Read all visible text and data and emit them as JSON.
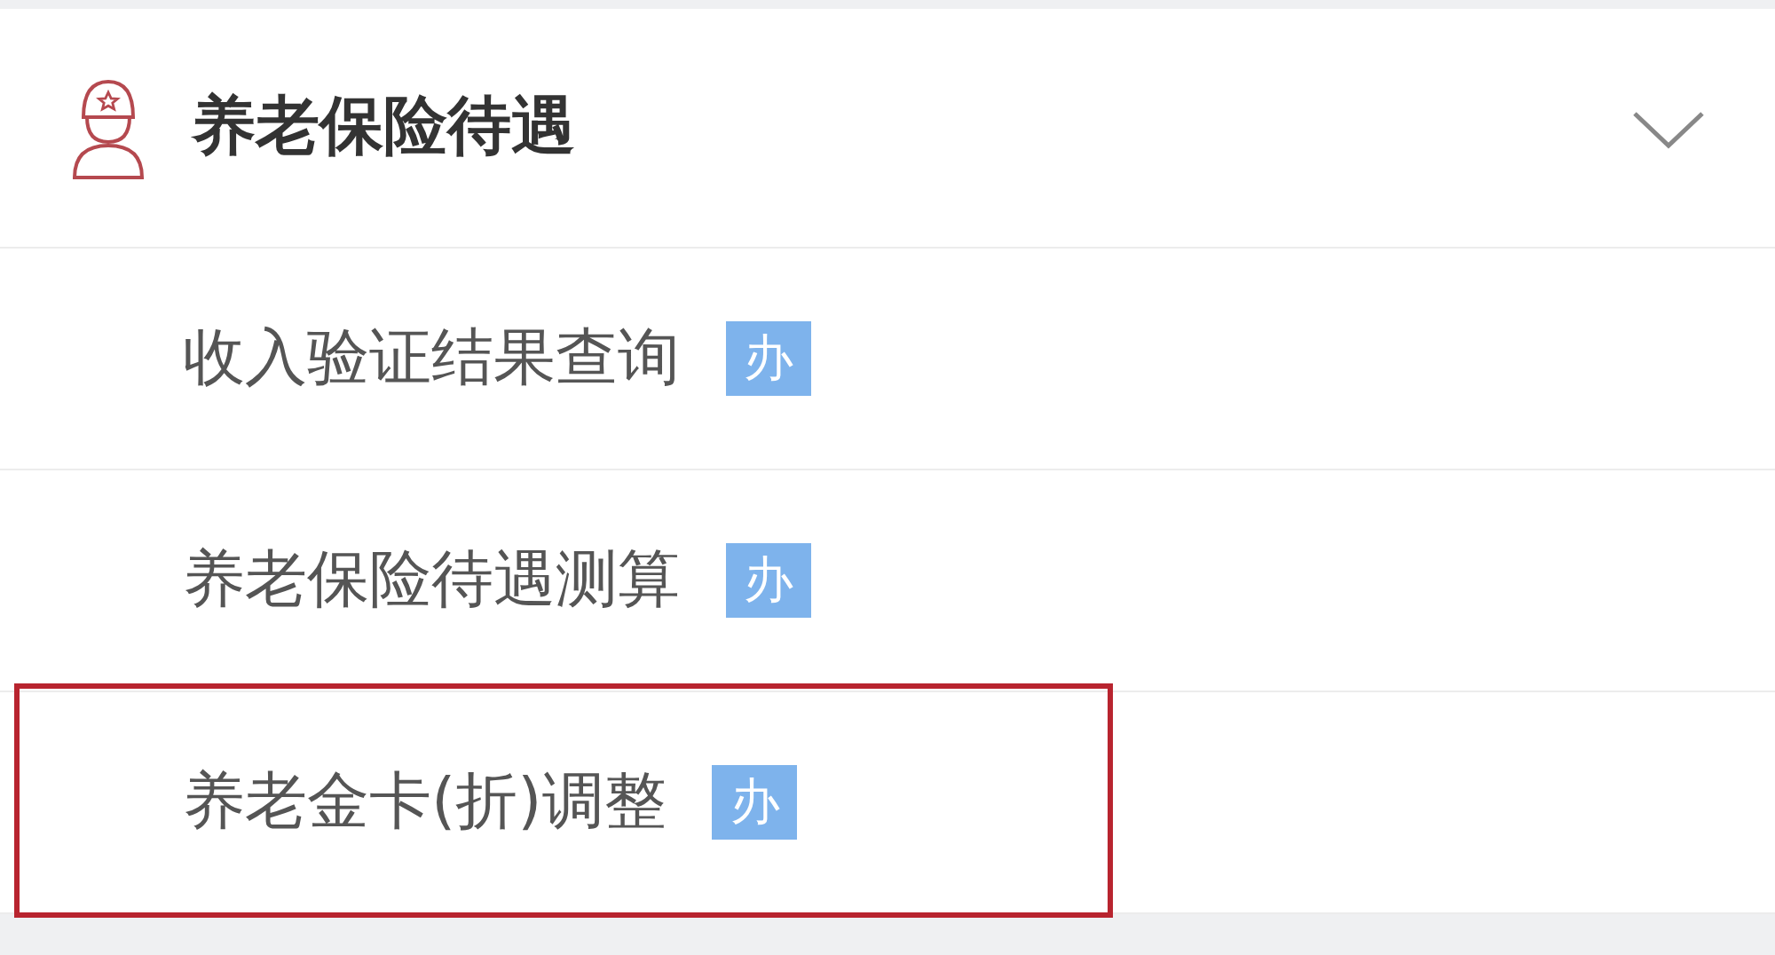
{
  "section": {
    "title": "养老保险待遇",
    "expanded": true
  },
  "items": [
    {
      "label": "收入验证结果查询",
      "badge": "办",
      "highlighted": false
    },
    {
      "label": "养老保险待遇测算",
      "badge": "办",
      "highlighted": false
    },
    {
      "label": "养老金卡(折)调整",
      "badge": "办",
      "highlighted": true
    }
  ]
}
